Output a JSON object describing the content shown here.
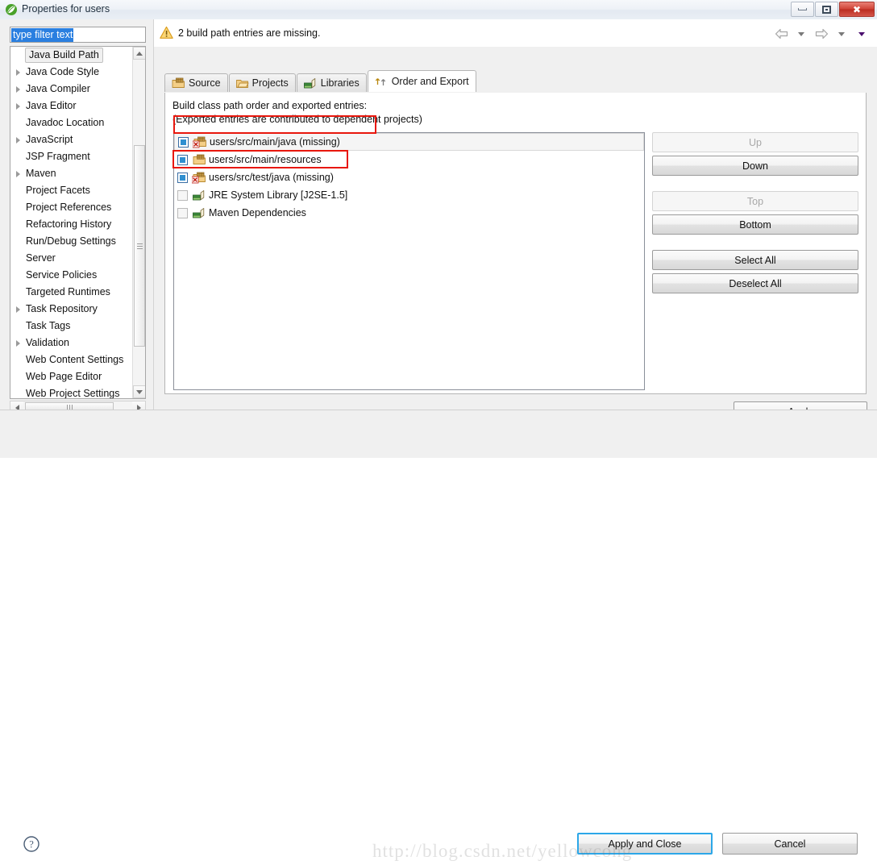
{
  "window": {
    "title": "Properties for users",
    "icon": "eclipse-leaf-icon",
    "minimize_label": "Minimize",
    "restore_label": "Restore",
    "close_label": "Close"
  },
  "filter": {
    "value": "type filter text",
    "placeholder": "type filter text"
  },
  "tree": {
    "items": [
      {
        "label": "Java Build Path",
        "expandable": false,
        "selected": true
      },
      {
        "label": "Java Code Style",
        "expandable": true,
        "selected": false
      },
      {
        "label": "Java Compiler",
        "expandable": true,
        "selected": false
      },
      {
        "label": "Java Editor",
        "expandable": true,
        "selected": false
      },
      {
        "label": "Javadoc Location",
        "expandable": false,
        "selected": false
      },
      {
        "label": "JavaScript",
        "expandable": true,
        "selected": false
      },
      {
        "label": "JSP Fragment",
        "expandable": false,
        "selected": false
      },
      {
        "label": "Maven",
        "expandable": true,
        "selected": false
      },
      {
        "label": "Project Facets",
        "expandable": false,
        "selected": false
      },
      {
        "label": "Project References",
        "expandable": false,
        "selected": false
      },
      {
        "label": "Refactoring History",
        "expandable": false,
        "selected": false
      },
      {
        "label": "Run/Debug Settings",
        "expandable": false,
        "selected": false
      },
      {
        "label": "Server",
        "expandable": false,
        "selected": false
      },
      {
        "label": "Service Policies",
        "expandable": false,
        "selected": false
      },
      {
        "label": "Targeted Runtimes",
        "expandable": false,
        "selected": false
      },
      {
        "label": "Task Repository",
        "expandable": true,
        "selected": false
      },
      {
        "label": "Task Tags",
        "expandable": false,
        "selected": false
      },
      {
        "label": "Validation",
        "expandable": true,
        "selected": false
      },
      {
        "label": "Web Content Settings",
        "expandable": false,
        "selected": false
      },
      {
        "label": "Web Page Editor",
        "expandable": false,
        "selected": false
      },
      {
        "label": "Web Project Settings",
        "expandable": false,
        "selected": false
      }
    ]
  },
  "message": {
    "icon": "warning-icon",
    "text": "2 build path entries are missing."
  },
  "nav": {
    "back_label": "Back",
    "back_menu_label": "Back history",
    "forward_label": "Forward",
    "forward_menu_label": "Forward history",
    "menu_label": "View menu"
  },
  "tabs": [
    {
      "label": "Source",
      "icon": "source-folder-icon",
      "active": false
    },
    {
      "label": "Projects",
      "icon": "projects-icon",
      "active": false
    },
    {
      "label": "Libraries",
      "icon": "libraries-icon",
      "active": false
    },
    {
      "label": "Order and Export",
      "icon": "order-export-icon",
      "active": true
    }
  ],
  "panel": {
    "description_line1": "Build class path order and exported entries:",
    "description_line2": "(Exported entries are contributed to dependent projects)",
    "entries": [
      {
        "label": "users/src/main/java (missing)",
        "checked": true,
        "icon": "source-folder-missing-icon",
        "selected": true,
        "highlighted": true
      },
      {
        "label": "users/src/main/resources",
        "checked": true,
        "icon": "source-folder-icon",
        "selected": false,
        "highlighted": false
      },
      {
        "label": "users/src/test/java (missing)",
        "checked": true,
        "icon": "source-folder-missing-icon",
        "selected": false,
        "highlighted": true
      },
      {
        "label": "JRE System Library [J2SE-1.5]",
        "checked": false,
        "icon": "library-icon",
        "selected": false,
        "highlighted": false
      },
      {
        "label": "Maven Dependencies",
        "checked": false,
        "icon": "library-icon",
        "selected": false,
        "highlighted": false
      }
    ],
    "buttons": [
      {
        "label": "Up",
        "disabled": true
      },
      {
        "label": "Down",
        "disabled": false
      },
      {
        "label": "Top",
        "disabled": true
      },
      {
        "label": "Bottom",
        "disabled": false
      },
      {
        "label": "Select All",
        "disabled": false
      },
      {
        "label": "Deselect All",
        "disabled": false
      }
    ]
  },
  "footer": {
    "apply_label": "Apply",
    "help_label": "Help",
    "apply_and_close_label": "Apply and Close",
    "cancel_label": "Cancel",
    "watermark": "http://blog.csdn.net/yellowcong"
  },
  "colors": {
    "accent": "#2ca7e8",
    "highlight_box": "#e8170d",
    "selection": "#2a7fe0",
    "warning": "#f5b800",
    "close_button": "#cf4134"
  }
}
